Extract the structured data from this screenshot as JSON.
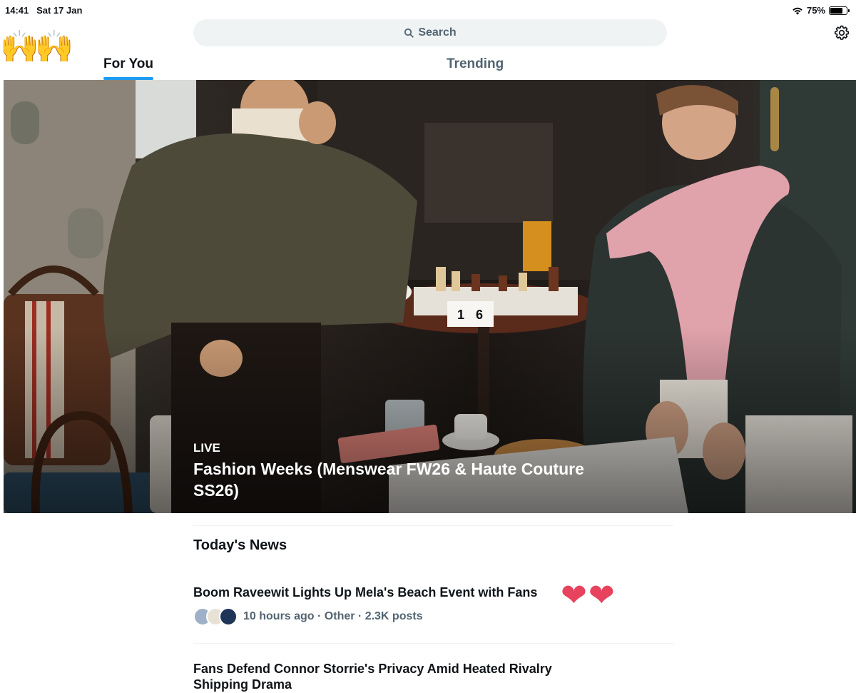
{
  "status_bar": {
    "time": "14:41",
    "date": "Sat 17 Jan",
    "battery_percent": "75%",
    "battery_level": 0.75
  },
  "decorations": {
    "hands_emoji": "🙌",
    "hearts_emoji": "❤❤"
  },
  "search": {
    "label": "Search"
  },
  "tabs": [
    {
      "label": "For You",
      "selected": true
    },
    {
      "label": "Trending",
      "selected": false
    }
  ],
  "hero": {
    "badge": "LIVE",
    "title": "Fashion Weeks (Menswear FW26 & Haute Couture SS26)"
  },
  "sections": {
    "todays_news": "Today's News"
  },
  "news": [
    {
      "headline": "Boom Raveewit Lights Up Mela's Beach Event with Fans",
      "meta": "10 hours ago · Other · 2.3K posts"
    },
    {
      "headline": "Fans Defend Connor Storrie's Privacy Amid Heated Rivalry Shipping Drama"
    }
  ],
  "colors": {
    "accent": "#1d9bf0",
    "secondary_text": "#536471",
    "search_bg": "#eff3f4",
    "heart": "#e8435e"
  },
  "icons": {
    "search": "search-icon",
    "settings": "gear-icon",
    "wifi": "wifi-icon",
    "battery": "battery-icon"
  }
}
